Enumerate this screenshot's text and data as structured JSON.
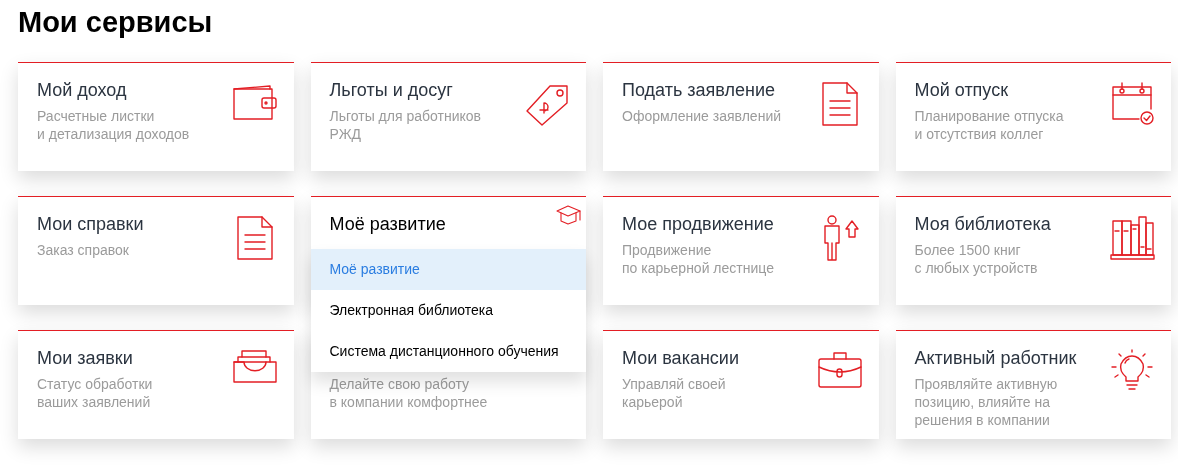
{
  "title": "Мои сервисы",
  "cards": [
    {
      "title": "Мой доход",
      "subtitle": [
        "Расчетные листки",
        "и детализация доходов"
      ],
      "expanded": false
    },
    {
      "title": "Льготы и досуг",
      "subtitle": [
        "Льготы для работников",
        "РЖД"
      ],
      "expanded": false
    },
    {
      "title": "Подать заявление",
      "subtitle": [
        "Оформление заявлений"
      ],
      "expanded": false
    },
    {
      "title": "Мой отпуск",
      "subtitle": [
        "Планирование отпуска",
        "и отсутствия коллег"
      ],
      "expanded": false
    },
    {
      "title": "Мои справки",
      "subtitle": [
        "Заказ справок"
      ],
      "expanded": false
    },
    {
      "title": "Моё развитие",
      "expanded": true,
      "menu": [
        {
          "label": "Моё развитие",
          "selected": true
        },
        {
          "label": "Электронная библиотека",
          "selected": false
        },
        {
          "label": "Система дистанционного обучения",
          "selected": false
        }
      ]
    },
    {
      "title": "Мое продвижение",
      "subtitle": [
        "Продвижение",
        "по карьерной лестнице"
      ],
      "expanded": false
    },
    {
      "title": "Моя библиотека",
      "subtitle": [
        "Более 1500 книг",
        "с любых устройств"
      ],
      "expanded": false
    },
    {
      "title": "Мои заявки",
      "subtitle": [
        "Статус обработки",
        "ваших заявлений"
      ],
      "expanded": false
    },
    {
      "subtitle": [
        "Делайте свою работу",
        "в компании комфортнее"
      ],
      "expanded": false
    },
    {
      "title": "Мои вакансии",
      "subtitle": [
        "Управляй своей",
        "карьерой"
      ],
      "expanded": false
    },
    {
      "title": "Активный работник",
      "subtitle": [
        "Проявляйте активную",
        "позицию, влияйте на",
        "решения в компании"
      ],
      "expanded": false
    }
  ]
}
